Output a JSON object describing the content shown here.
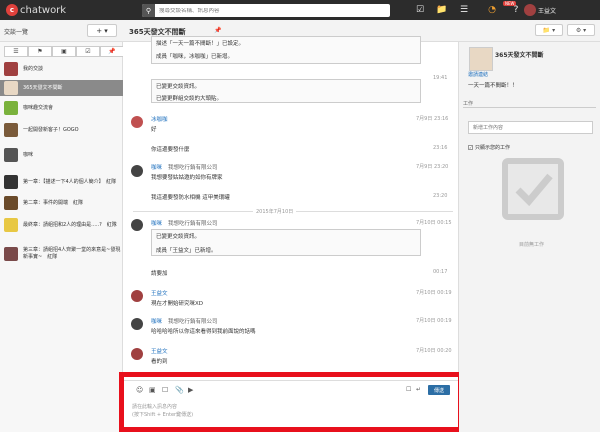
{
  "app": {
    "logo_text": "chatwork",
    "logo_mark": "c"
  },
  "search": {
    "placeholder": "搜尋交談名稱、訊息內容"
  },
  "topbar": {
    "new_badge": "NEW",
    "username": "王益文"
  },
  "left": {
    "title": "交談一覽",
    "add_label": "+",
    "rooms": [
      {
        "name": "我的交談",
        "color": "#a04040"
      },
      {
        "name": "365天發文不間斷",
        "color": "#e8d8c4",
        "active": true
      },
      {
        "name": "咖咪趣交流會",
        "color": "#7ab23c"
      },
      {
        "name": "一起開發新客子！GOGO",
        "color": "#7a5a3a"
      },
      {
        "name": "咖咪",
        "color": "#555"
      },
      {
        "name": "第一章：【描述一下4人的個人簡介】　紅隊",
        "color": "#333"
      },
      {
        "name": "第二章：事件的開端　紅隊",
        "color": "#6a4a2a"
      },
      {
        "name": "最終章：請組招和2人的理由是.....?　紅隊",
        "color": "#e8c844"
      },
      {
        "name": "第三章：請組招4人齊聚一堂的來意是~發現新事實~　紅隊",
        "color": "#7a4a4a"
      }
    ]
  },
  "room": {
    "title": "365天發文不間斷"
  },
  "messages": {
    "top_box_line1": "描述「一天一篇不間斷！」已設定。",
    "top_box_line2": "成員「咖咪，冰咖咖」已新增。",
    "time_1": "19:41",
    "box2_line1": "已變更交談資訊。",
    "box2_line2": "已變更群組交談的大頭貼。",
    "m1_name": "冰咖咖",
    "m1_text": "好",
    "m1_time": "7月9日 23:16",
    "m1_text2": "你這邊要發什麼",
    "m1_time2": "23:16",
    "m2_name": "咖咪",
    "m2_org": "我想吃行銷有限公司",
    "m2_time": "7月9日 23:20",
    "m2_text": "我想要發姑姑邀約如你有牌家",
    "m2_text2": "我這邊要發防水相機 這甲美環罐",
    "m2_time2": "23:20",
    "date_sep": "2015年7月10日",
    "m3_name": "咖咪",
    "m3_org": "我想吃行銷有限公司",
    "m3_time": "7月10日 00:15",
    "m3_box_line1": "已變更交談資訊。",
    "m3_box_line2": "成員「王益文」已新增。",
    "m3_text": "請要加",
    "m3_time2": "00:17",
    "m4_name": "王益文",
    "m4_text": "現在才開始研究咪XD",
    "m4_time": "7月10日 00:19",
    "m5_name": "咖咪",
    "m5_org": "我想吃行銷有限公司",
    "m5_time": "7月10日 00:19",
    "m5_text": "哈哈哈哈所以你這來看得到我前面說的話嗎",
    "m6_name": "王益文",
    "m6_text": "看的到",
    "m6_time": "7月10日 00:20"
  },
  "composer": {
    "send_label": "傳送",
    "placeholder_line1": "請在此輸入訊息內容",
    "placeholder_line2": "(按下Shift + Enter鍵傳送)",
    "enter_toggle": "↵"
  },
  "right": {
    "room_title": "365天發文不間斷",
    "link": "邀請連結",
    "desc": "一天一篇不間斷！！",
    "section_task": "工作",
    "task_placeholder": "新增工作內容",
    "show_done": "只顯示您的工作",
    "empty_label": "目前無工作"
  },
  "colors": {
    "accent": "#2c6ea5",
    "red_frame": "#e8101c",
    "topbar": "#2c2c2c"
  }
}
